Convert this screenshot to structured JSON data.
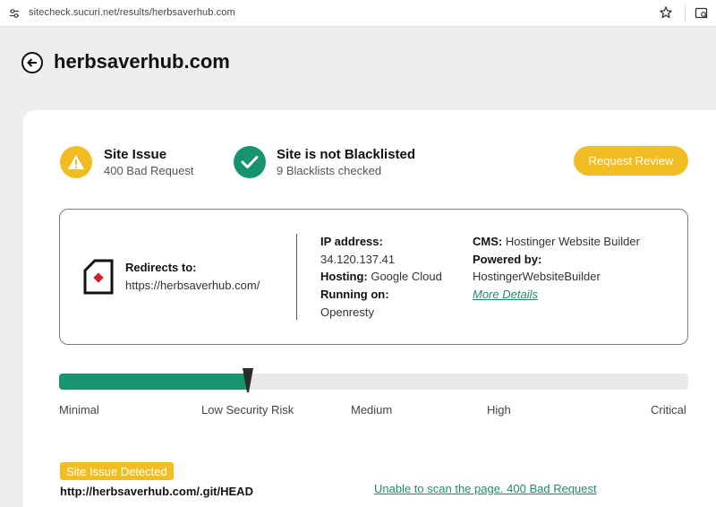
{
  "browser": {
    "url": "sitecheck.sucuri.net/results/herbsaverhub.com",
    "icons": [
      "site-info-icon",
      "bookmark-star-icon",
      "reader-view-icon"
    ]
  },
  "header": {
    "title": "herbsaverhub.com",
    "back_icon": "arrow-left-circle-icon"
  },
  "status": {
    "issue": {
      "title": "Site Issue",
      "subtitle": "400 Bad Request",
      "icon": "warning-triangle-icon",
      "color": "#f2bd23"
    },
    "blacklist": {
      "title": "Site is not Blacklisted",
      "subtitle": "9 Blacklists checked",
      "icon": "checkmark-icon",
      "color": "#17936f"
    },
    "review_button": "Request Review"
  },
  "info": {
    "redirect_label": "Redirects to:",
    "redirect_url": "https://herbsaverhub.com/",
    "ip_label": "IP address:",
    "ip_value": "34.120.137.41",
    "hosting_label": "Hosting:",
    "hosting_value": "Google Cloud",
    "running_label": "Running on:",
    "running_value": "Openresty",
    "cms_label": "CMS:",
    "cms_value": "Hostinger Website Builder",
    "powered_label": "Powered by:",
    "powered_value": "HostingerWebsiteBuilder",
    "more_details": "More Details"
  },
  "risk": {
    "labels": [
      "Minimal",
      "Low Security Risk",
      "Medium",
      "High",
      "Critical"
    ],
    "level_fraction": 0.3,
    "fill_color": "#17936f"
  },
  "issue_detected": {
    "badge": "Site Issue Detected",
    "url": "http://herbsaverhub.com/.git/HEAD",
    "message": "Unable to scan the page. 400 Bad Request"
  }
}
